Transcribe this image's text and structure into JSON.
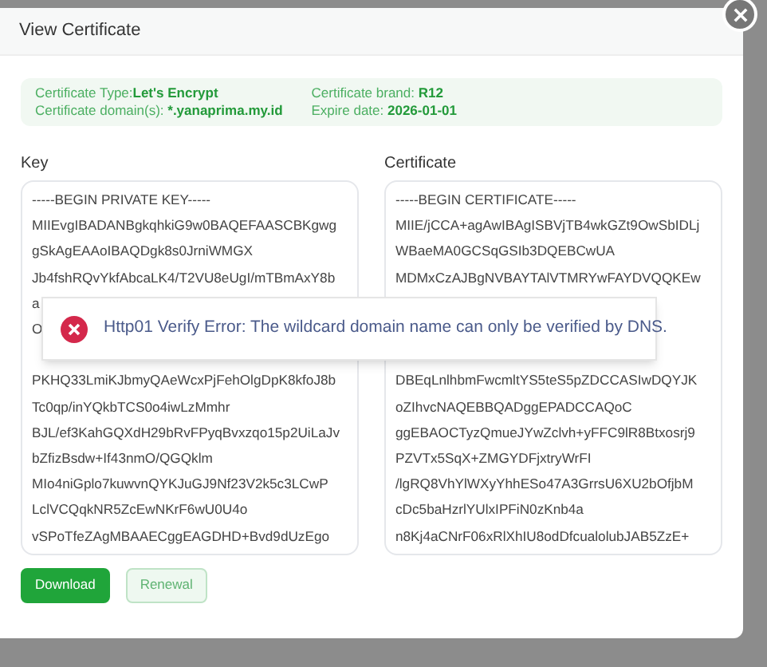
{
  "dialog": {
    "title": "View Certificate"
  },
  "info": [
    {
      "label": "Certificate Type:",
      "value": "Let's Encrypt"
    },
    {
      "label": "Certificate brand: ",
      "value": "R12"
    },
    {
      "label": "Certificate domain(s): ",
      "value": "*.yanaprima.my.id"
    },
    {
      "label": "Expire date: ",
      "value": "2026-01-01"
    }
  ],
  "key": {
    "label": "Key",
    "lines_before": [
      "-----BEGIN PRIVATE KEY-----",
      "MIIEvgIBADANBgkqhkiG9w0BAQEFAASCBKgwg",
      "gSkAgEAAoIBAQDgk8s0JrniWMGX",
      "Jb4fshRQvYkfAbcaLK4/T2VU8eUgI/mTBmAxY8b",
      "a",
      "O"
    ],
    "lines_after": [
      "PKHQ33LmiKJbmyQAeWcxPjFehOlgDpK8kfoJ8b",
      "Tc0qp/inYQkbTCS0o4iwLzMmhr",
      "BJL/ef3KahGQXdH29bRvFPyqBvxzqo15p2UiLaJv",
      "bZfizBsdw+If43nmO/QGQklm",
      "MIo4niGplo7kuwvnQYKJuGJ9Nf23V2k5c3LCwP",
      "LclVCQqkNR5ZcEwNKrF6wU0U4o",
      "vSPoTfeZAgMBAAECggEAGDHD+Bvd9dUzEgo"
    ]
  },
  "certificate": {
    "label": "Certificate",
    "lines_before": [
      "-----BEGIN CERTIFICATE-----",
      "MIIE/jCCA+agAwIBAgISBVjTB4wkGZt9OwSbIDLj",
      "WBaeMA0GCSqGSIb3DQEBCwUA",
      "MDMxCzAJBgNVBAYTAlVTMRYwFAYDVQQKEw"
    ],
    "lines_after": [
      "DBEqLnlhbmFwcmltYS5teS5pZDCCASIwDQYJK",
      "oZIhvcNAQEBBQADggEPADCCAQoC",
      "ggEBAOCTyzQmueJYwZclvh+yFFC9lR8Btxosrj9",
      "PZVTx5SqX+ZMGYDFjxtryWrFI",
      "/lgRQ8VhYlWXyYhhESo47A3GrrsU6XU2bOfjbM",
      "cDc5baHzrlYUlxIPFiN0zKnb4a",
      "n8Kj4aCNrF06xRlXhIU8odDfcualolubJAB5ZzE+"
    ]
  },
  "buttons": [
    {
      "label": "Download",
      "kind": "primary"
    },
    {
      "label": "Renewal",
      "kind": "secondary"
    }
  ],
  "toast": {
    "message": "Http01 Verify Error: The wildcard domain name can only be verified by DNS."
  }
}
